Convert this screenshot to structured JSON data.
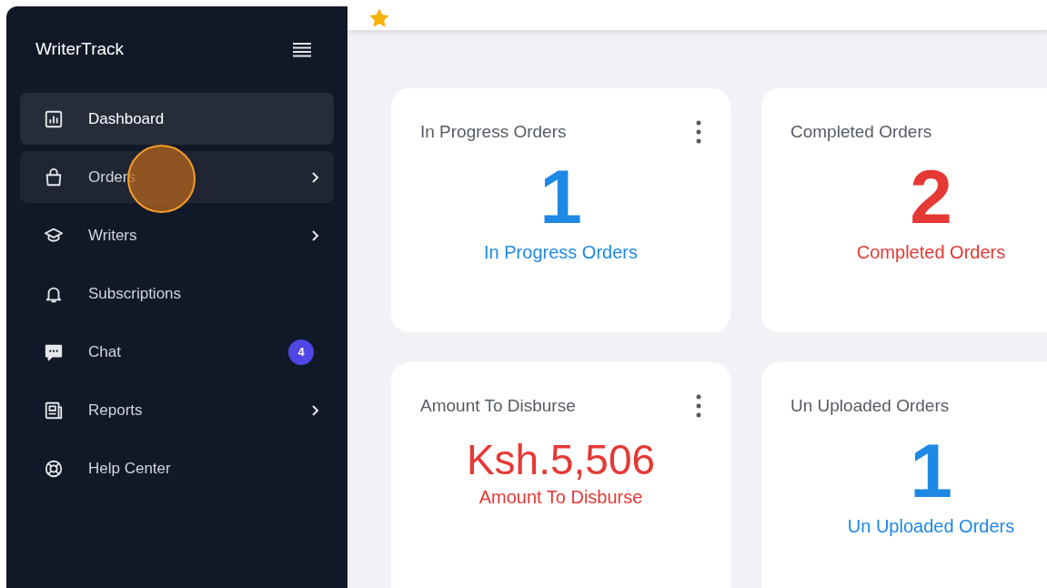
{
  "sidebar": {
    "brand": "WriterTrack",
    "items": [
      {
        "label": "Dashboard",
        "selected": true,
        "hovered": false,
        "expandable": false
      },
      {
        "label": "Orders",
        "selected": false,
        "hovered": true,
        "expandable": true
      },
      {
        "label": "Writers",
        "selected": false,
        "hovered": false,
        "expandable": true
      },
      {
        "label": "Subscriptions",
        "selected": false,
        "hovered": false,
        "expandable": false
      },
      {
        "label": "Chat",
        "selected": false,
        "hovered": false,
        "expandable": false,
        "badge": "4"
      },
      {
        "label": "Reports",
        "selected": false,
        "hovered": false,
        "expandable": true
      },
      {
        "label": "Help Center",
        "selected": false,
        "hovered": false,
        "expandable": false
      }
    ]
  },
  "cards": [
    {
      "title": "In Progress Orders",
      "value": "1",
      "caption": "In Progress Orders",
      "color": "#1e88e5",
      "menu": true
    },
    {
      "title": "Completed Orders",
      "value": "2",
      "caption": "Completed Orders",
      "color": "#e53935"
    },
    {
      "title": "Amount To Disburse",
      "value": "Ksh.5,506",
      "caption": "Amount To Disburse",
      "color": "#e53935",
      "menu": true
    },
    {
      "title": "Un Uploaded Orders",
      "value": "1",
      "caption": "Un Uploaded Orders",
      "color": "#1e88e5"
    }
  ]
}
